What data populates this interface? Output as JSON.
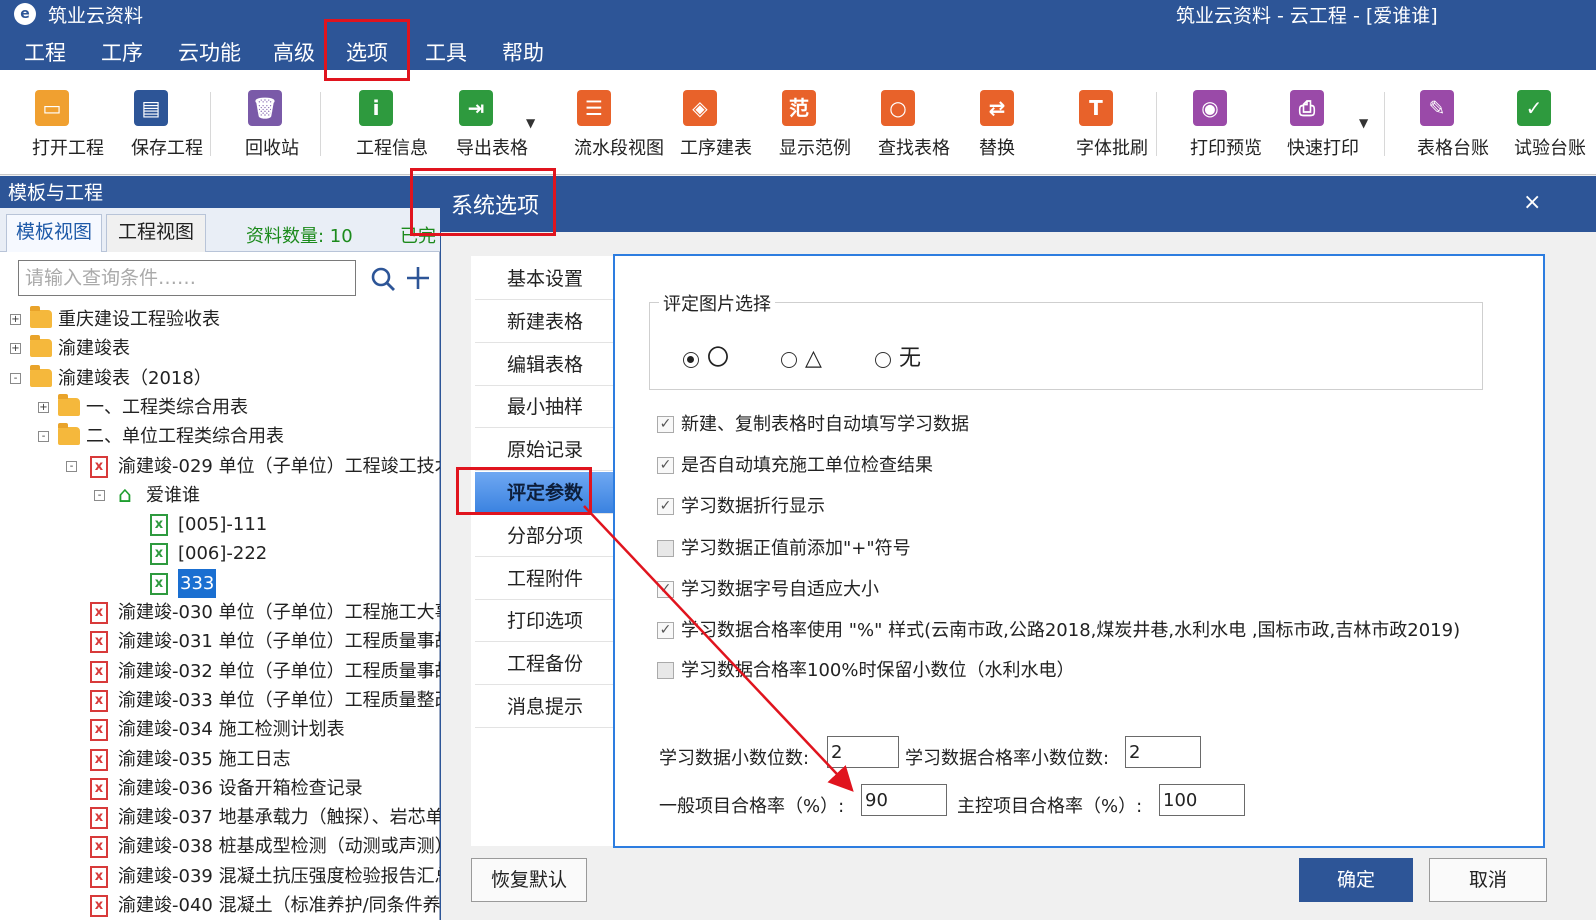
{
  "app": {
    "name": "筑业云资料",
    "window_title": "筑业云资料 - 云工程 - [爱谁谁]"
  },
  "menu": [
    "工程",
    "工序",
    "云功能",
    "高级",
    "选项",
    "工具",
    "帮助"
  ],
  "toolbar": [
    {
      "label": "打开工程",
      "icon": "folder-open-icon",
      "color": "#f0a030"
    },
    {
      "label": "保存工程",
      "icon": "save-icon",
      "color": "#2d5597"
    },
    {
      "label": "回收站",
      "icon": "trash-icon",
      "color": "#7a5aa8"
    },
    {
      "label": "工程信息",
      "icon": "info-icon",
      "color": "#2e9a3e"
    },
    {
      "label": "导出表格",
      "icon": "export-icon",
      "color": "#2e9a3e"
    },
    {
      "label": "流水段视图",
      "icon": "list-view-icon",
      "color": "#e8622a"
    },
    {
      "label": "工序建表",
      "icon": "layers-icon",
      "color": "#e8622a"
    },
    {
      "label": "显示范例",
      "icon": "example-icon",
      "color": "#e8622a"
    },
    {
      "label": "查找表格",
      "icon": "search-icon",
      "color": "#e8622a"
    },
    {
      "label": "替换",
      "icon": "replace-icon",
      "color": "#e8622a"
    },
    {
      "label": "字体批刷",
      "icon": "font-brush-icon",
      "color": "#e8622a"
    },
    {
      "label": "打印预览",
      "icon": "eye-icon",
      "color": "#9a4aa8"
    },
    {
      "label": "快速打印",
      "icon": "printer-icon",
      "color": "#9a4aa8"
    },
    {
      "label": "表格台账",
      "icon": "ledger-icon",
      "color": "#9a4aa8"
    },
    {
      "label": "试验台账",
      "icon": "test-ledger-icon",
      "color": "#2e9a3e"
    }
  ],
  "left_panel": {
    "header": "模板与工程",
    "tabs": [
      "模板视图",
      "工程视图"
    ],
    "doc_count": "资料数量: 10",
    "done_label": "已完",
    "search_placeholder": "请输入查询条件……"
  },
  "tree": [
    {
      "text": "重庆建设工程验收表",
      "level": 0,
      "icon": "folder",
      "exp": "+"
    },
    {
      "text": "渝建竣表",
      "level": 0,
      "icon": "folder",
      "exp": "+"
    },
    {
      "text": "渝建竣表（2018）",
      "level": 0,
      "icon": "folder",
      "exp": "-"
    },
    {
      "text": "一、工程类综合用表",
      "level": 1,
      "icon": "folder",
      "exp": "+"
    },
    {
      "text": "二、单位工程类综合用表",
      "level": 1,
      "icon": "folder",
      "exp": "-"
    },
    {
      "text": "渝建竣-029 单位（子单位）工程竣工技术",
      "level": 2,
      "icon": "xls-red",
      "exp": "-"
    },
    {
      "text": "爱谁谁",
      "level": 3,
      "icon": "home",
      "exp": "-"
    },
    {
      "text": "[005]-111",
      "level": 4,
      "icon": "xls"
    },
    {
      "text": "[006]-222",
      "level": 4,
      "icon": "xls"
    },
    {
      "text": "333",
      "level": 4,
      "icon": "xls",
      "selected": true
    },
    {
      "text": "渝建竣-030 单位（子单位）工程施工大事",
      "level": 2,
      "icon": "xls-red"
    },
    {
      "text": "渝建竣-031 单位（子单位）工程质量事故",
      "level": 2,
      "icon": "xls-red"
    },
    {
      "text": "渝建竣-032 单位（子单位）工程质量事故",
      "level": 2,
      "icon": "xls-red"
    },
    {
      "text": "渝建竣-033 单位（子单位）工程质量整改",
      "level": 2,
      "icon": "xls-red"
    },
    {
      "text": "渝建竣-034 施工检测计划表",
      "level": 2,
      "icon": "xls-red"
    },
    {
      "text": "渝建竣-035 施工日志",
      "level": 2,
      "icon": "xls-red"
    },
    {
      "text": "渝建竣-036 设备开箱检查记录",
      "level": 2,
      "icon": "xls-red"
    },
    {
      "text": "渝建竣-037 地基承载力（触探）、岩芯单",
      "level": 2,
      "icon": "xls-red"
    },
    {
      "text": "渝建竣-038 桩基成型检测（动测或声测）",
      "level": 2,
      "icon": "xls-red"
    },
    {
      "text": "渝建竣-039 混凝土抗压强度检验报告汇总",
      "level": 2,
      "icon": "xls-red"
    },
    {
      "text": "渝建竣-040 混凝土（标准养护/同条件养",
      "level": 2,
      "icon": "xls-red"
    }
  ],
  "dialog": {
    "title": "系统选项",
    "close": "×",
    "nav": [
      "基本设置",
      "新建表格",
      "编辑表格",
      "最小抽样",
      "原始记录",
      "评定参数",
      "分部分项",
      "工程附件",
      "打印选项",
      "工程备份",
      "消息提示"
    ],
    "active_nav": "评定参数",
    "image_section": {
      "legend": "评定图片选择",
      "options": [
        {
          "label": "〇",
          "selected": true
        },
        {
          "label": "△",
          "selected": false
        },
        {
          "label": "无",
          "selected": false
        }
      ]
    },
    "checkboxes": [
      {
        "label": "新建、复制表格时自动填写学习数据",
        "checked": true
      },
      {
        "label": "是否自动填充施工单位检查结果",
        "checked": true
      },
      {
        "label": "学习数据折行显示",
        "checked": true
      },
      {
        "label": "学习数据正值前添加\"+\"符号",
        "checked": false
      },
      {
        "label": "学习数据字号自适应大小",
        "checked": true
      },
      {
        "label": "学习数据合格率使用 \"%\" 样式(云南市政,公路2018,煤炭井巷,水利水电 ,国标市政,吉林市政2019)",
        "checked": true
      },
      {
        "label": "学习数据合格率100%时保留小数位（水利水电）",
        "checked": false
      }
    ],
    "fields": {
      "decimal_label": "学习数据小数位数:",
      "decimal_value": "2",
      "pass_decimal_label": "学习数据合格率小数位数:",
      "pass_decimal_value": "2",
      "general_label": "一般项目合格率（%）:",
      "general_value": "90",
      "main_label": "主控项目合格率（%）:",
      "main_value": "100"
    },
    "buttons": {
      "reset": "恢复默认",
      "ok": "确定",
      "cancel": "取消"
    }
  },
  "colors": {
    "titlebar": "#2d5597",
    "accent": "#2d7de0",
    "highlight": "#e0141e"
  }
}
